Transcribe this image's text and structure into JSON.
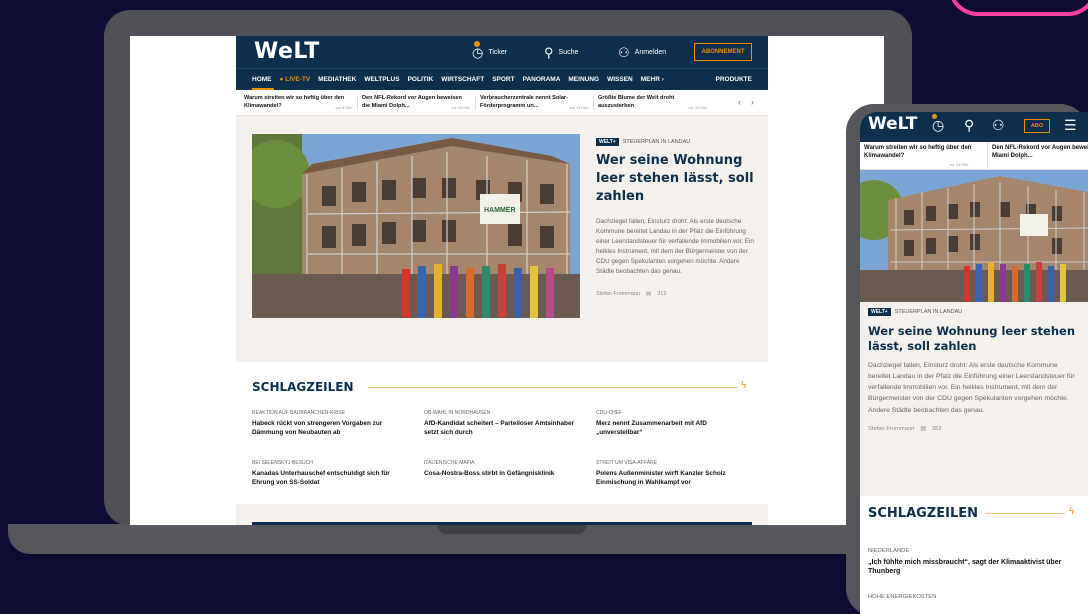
{
  "brand": {
    "logo": "WeLT",
    "accent": "#f28f00",
    "navy": "#0b2f4d"
  },
  "desktop": {
    "topbar": {
      "ticker": "Ticker",
      "suche": "Suche",
      "anmelden": "Anmelden",
      "abo": "ABONNEMENT"
    },
    "nav": {
      "items": [
        "HOME",
        "● LIVE-TV",
        "MEDIATHEK",
        "WELTPLUS",
        "POLITIK",
        "WIRTSCHAFT",
        "SPORT",
        "PANORAMA",
        "MEINUNG",
        "WISSEN",
        "MEHR ›"
      ],
      "produkte": "PRODUKTE"
    },
    "ticker": [
      {
        "text": "Warum streiten wir so heftig über den Klimawandel?",
        "time": "vor 8 Min."
      },
      {
        "text": "Den NFL-Rekord vor Augen beweisen die Miami Dolph...",
        "time": "vor 10 Min."
      },
      {
        "text": "Verbraucherzentrale nennt Solar-Förderprogramm un...",
        "time": "vor 11 Min."
      },
      {
        "text": "Größte Blume der Welt droht auszusterben",
        "time": "vor 14 Min."
      }
    ],
    "hero": {
      "tag": "WELT+",
      "kicker": "STEUERPLAN IN LANDAU",
      "title": "Wer seine Wohnung leer stehen lässt, soll zahlen",
      "desc": "Dachziegel fallen, Einsturz droht: Als erste deutsche Kommune bereitet Landau in der Pfalz die Einführung einer Leerstandsteuer für verfallende Immobilien vor. Ein heikles Instrument, mit dem der Bürgermeister von der CDU gegen Spekulanten vorgehen möchte. Andere Städte beobachten das genau.",
      "author": "Stefan Frommann",
      "comments": "312",
      "sign": "HAMMER"
    },
    "schlagzeilen": {
      "heading": "SCHLAGZEILEN",
      "items": [
        {
          "kicker": "REAKTION AUF BAUBRANCHEN-KRISE",
          "title": "Habeck rückt von strengeren Vorgaben zur Dämmung von Neubauten ab"
        },
        {
          "kicker": "OB-WAHL IN NORDHAUSEN",
          "title": "AfD-Kandidat scheitert – Parteiloser Amtsinhaber setzt sich durch"
        },
        {
          "kicker": "CDU-CHEF",
          "title": "Merz nennt Zusammenarbeit mit AfD „unverstellbar“"
        },
        {
          "kicker": "BEI SELENSKYJ-BESUCH",
          "title": "Kanadas Unterhauschef entschuldigt sich für Ehrung von SS-Soldat"
        },
        {
          "kicker": "ITALIENISCHE MAFIA",
          "title": "Cosa-Nostra-Boss stirbt in Gefängnisklinik"
        },
        {
          "kicker": "STREIT UM VISA-AFFÄRE",
          "title": "Polens Außenminister wirft Kanzler Scholz Einmischung in Wahlkampf vor"
        }
      ]
    }
  },
  "mobile": {
    "logo": "WeLT",
    "abo": "ABO",
    "ticker": [
      {
        "text": "Warum streiten wir so heftig über den Klimawandel?",
        "time": "vor 12 Min."
      },
      {
        "text": "Den NFL-Rekord vor Augen beweisen die Miami Dolph...",
        "time": ""
      }
    ],
    "hero": {
      "tag": "WELT+",
      "kicker": "STEUERPLAN IN LANDAU",
      "title": "Wer seine Wohnung leer stehen lässt, soll zahlen",
      "desc": "Dachziegel fallen, Einsturz droht: Als erste deutsche Kommune bereitet Landau in der Pfalz die Einführung einer Leerstandsteuer für verfallende Immobilien vor. Ein heikles Instrument, mit dem der Bürgermeister von der CDU gegen Spekulanten vorgehen möchte. Andere Städte beobachten das genau.",
      "author": "Stefan Frommann",
      "comments": "352"
    },
    "schlagzeilen": {
      "heading": "SCHLAGZEILEN",
      "items": [
        {
          "kicker": "NIEDERLANDE",
          "title": "„Ich fühlte mich missbraucht“, sagt der Klimaaktivist über Thunberg"
        },
        {
          "kicker": "HOHE ENERGIEKOSTEN",
          "title": ""
        }
      ]
    }
  }
}
